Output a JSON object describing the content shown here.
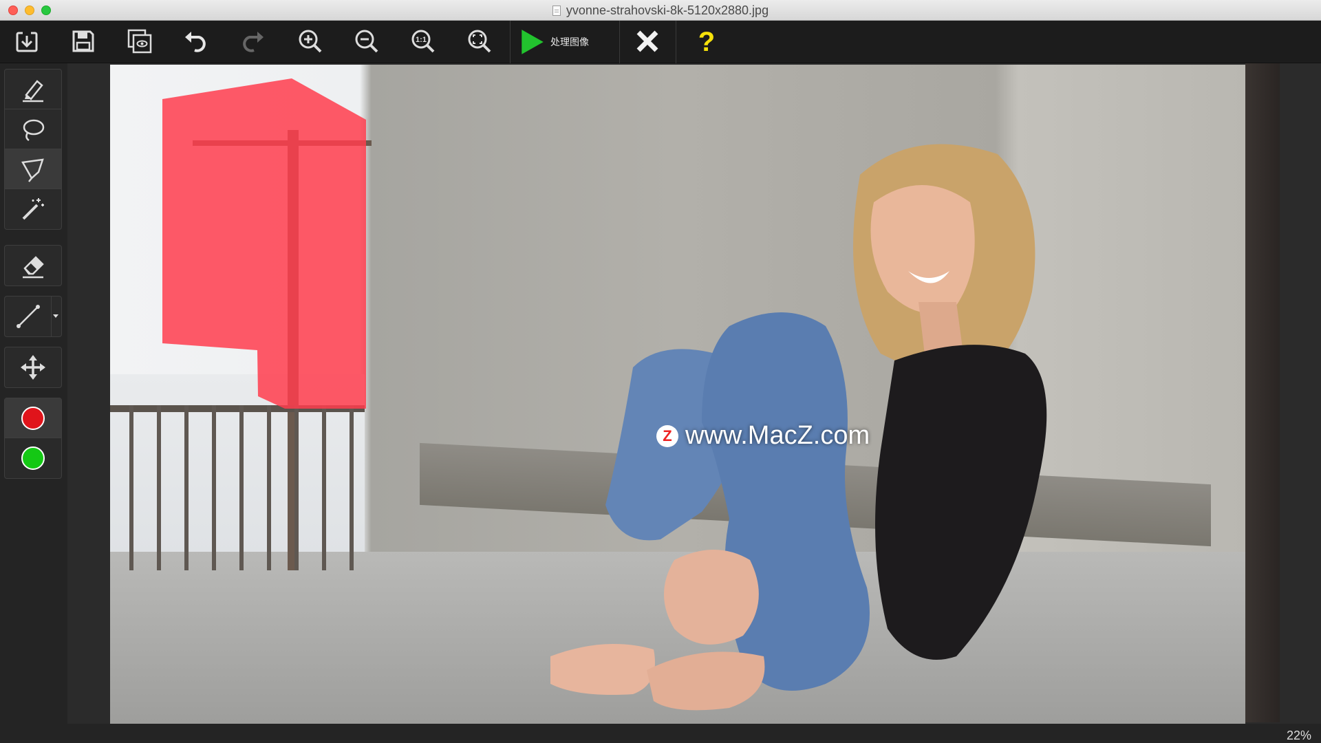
{
  "window": {
    "title": "yvonne-strahovski-8k-5120x2880.jpg"
  },
  "toolbar": {
    "buttons": [
      {
        "name": "import",
        "icon": "import-icon"
      },
      {
        "name": "save",
        "icon": "save-icon"
      },
      {
        "name": "preview",
        "icon": "preview-icon"
      },
      {
        "name": "undo",
        "icon": "undo-icon"
      },
      {
        "name": "redo",
        "icon": "redo-icon",
        "enabled": false
      },
      {
        "name": "zoom-in",
        "icon": "zoom-in-icon"
      },
      {
        "name": "zoom-out",
        "icon": "zoom-out-icon"
      },
      {
        "name": "actual-size",
        "icon": "actual-size-icon",
        "label": "1:1"
      },
      {
        "name": "fit-screen",
        "icon": "fit-screen-icon"
      }
    ],
    "process_label": "处理图像",
    "cancel_icon": "close-icon",
    "help_label": "?"
  },
  "tools": {
    "groups": [
      [
        "marker-icon",
        "lasso-icon",
        "polygon-lasso-icon",
        "magic-wand-icon"
      ],
      [
        "eraser-icon"
      ],
      [
        "line-icon"
      ],
      [
        "move-icon"
      ],
      [
        "red-color",
        "green-color"
      ]
    ],
    "selected": "polygon-lasso-icon",
    "colors": {
      "remove": "#e0141b",
      "keep": "#14c814"
    }
  },
  "canvas": {
    "watermark_logo": "Z",
    "watermark_text": "www.MacZ.com"
  },
  "status": {
    "zoom": "22%"
  },
  "colors": {
    "accent_green": "#22c32e",
    "help_yellow": "#f5e10a",
    "mask_red": "#ff3d4d"
  }
}
